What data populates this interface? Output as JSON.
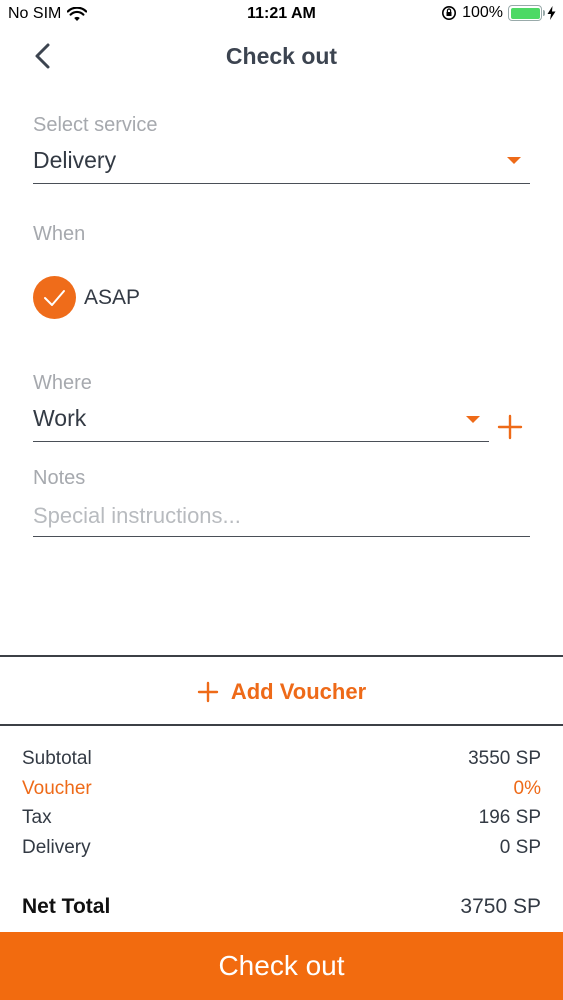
{
  "status_bar": {
    "carrier": "No SIM",
    "time": "11:21 AM",
    "battery": "100%"
  },
  "nav": {
    "title": "Check out",
    "back_icon": "chevron-left-icon"
  },
  "service": {
    "label": "Select service",
    "value": "Delivery",
    "dropdown_icon": "caret-down-icon"
  },
  "when": {
    "label": "When",
    "option_label": "ASAP",
    "checked": true
  },
  "where": {
    "label": "Where",
    "value": "Work",
    "dropdown_icon": "caret-down-icon",
    "add_icon": "plus-icon"
  },
  "notes": {
    "label": "Notes",
    "placeholder": "Special instructions..."
  },
  "voucher": {
    "button_label": "Add Voucher",
    "icon": "plus-icon"
  },
  "summary": {
    "subtotal": {
      "label": "Subtotal",
      "value": "3550 SP"
    },
    "voucher": {
      "label": "Voucher",
      "value": "0%"
    },
    "tax": {
      "label": "Tax",
      "value": "196 SP"
    },
    "delivery": {
      "label": "Delivery",
      "value": "0 SP"
    },
    "net_total": {
      "label": "Net Total",
      "value": "3750 SP"
    }
  },
  "checkout_button": {
    "label": "Check out"
  },
  "colors": {
    "accent": "#ee6a18",
    "checkout_bg": "#f26b0f",
    "battery": "#4cd964"
  }
}
